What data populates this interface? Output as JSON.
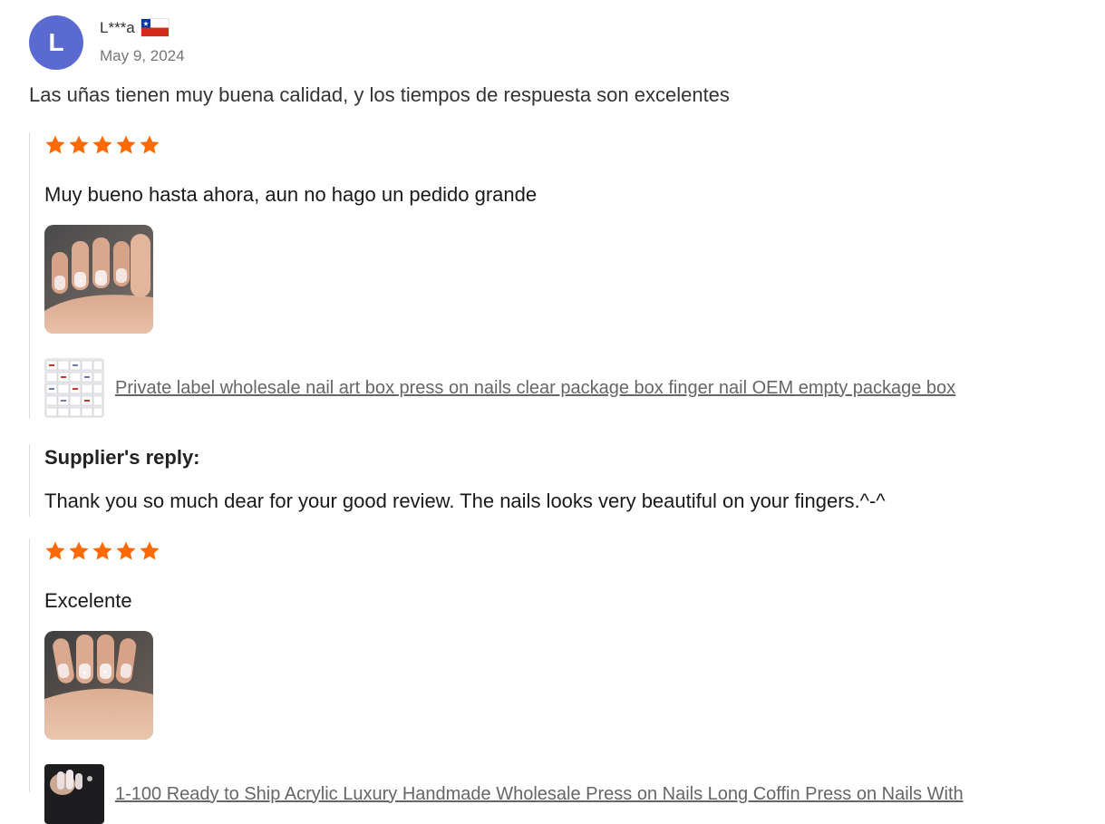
{
  "reviewer": {
    "initial": "L",
    "name": "L***a",
    "date": "May 9, 2024",
    "avatar_color": "#5b6ad0",
    "flag_icon": "chile-flag-icon"
  },
  "headline": "Las uñas tienen muy buena calidad, y los tiempos de respuesta son excelentes",
  "rating_color": "#ff6a00",
  "reviews": [
    {
      "stars": 5,
      "text": "Muy bueno hasta ahora, aun no hago un pedido grande",
      "product_link": "Private label wholesale nail art box press on nails clear package box finger nail OEM empty package box"
    },
    {
      "stars": 5,
      "text": "Excelente",
      "product_link": "1-100 Ready to Ship Acrylic Luxury Handmade Wholesale Press on Nails Long Coffin Press on Nails With"
    }
  ],
  "supplier_reply": {
    "heading": "Supplier's reply:",
    "text": "Thank you so much dear for your good review. The nails looks very beautiful on your fingers.^-^"
  }
}
